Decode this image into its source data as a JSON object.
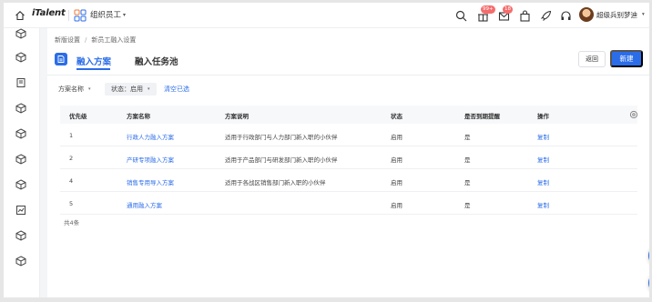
{
  "topbar": {
    "brand": "iTalent",
    "app_title": "组织员工",
    "chevron": "▾",
    "icons": [
      "home-icon",
      "apps-grid-icon",
      "search-icon",
      "gift-icon",
      "mail-icon",
      "bag-icon",
      "rocket-icon",
      "headset-icon"
    ],
    "badges": {
      "gift": "99+",
      "mail": "18"
    },
    "user_name": "超级兵别梦迪",
    "user_chevron": "▾"
  },
  "sidebar": {
    "icons": [
      "cube-icon",
      "cube-icon",
      "book-icon",
      "cube-icon",
      "cube-icon",
      "cube-icon",
      "cube-icon",
      "cube-icon",
      "chart-icon",
      "cube-icon",
      "cube-icon"
    ]
  },
  "breadcrumb": {
    "items": [
      "新版设置",
      "新员工融入设置"
    ],
    "separator": "/"
  },
  "tabs": [
    {
      "label": "融入方案",
      "active": true
    },
    {
      "label": "融入任务池",
      "active": false
    }
  ],
  "actions": {
    "back_label": "返回",
    "new_label": "新建"
  },
  "filters": {
    "name_label": "方案名称",
    "status_label": "状态：启用",
    "clear_label": "清空已选",
    "chevron": "▾"
  },
  "table": {
    "headers": [
      "优先级",
      "方案名称",
      "方案说明",
      "状态",
      "是否到期提醒",
      "操作"
    ],
    "rows": [
      {
        "priority": "1",
        "name": "行政人力融入方案",
        "desc": "适用于行政部门与人力部门新入职的小伙伴",
        "status": "启用",
        "remind": "是",
        "action": "复制"
      },
      {
        "priority": "2",
        "name": "产研专项融入方案",
        "desc": "适用于产品部门与研发部门新入职的小伙伴",
        "status": "启用",
        "remind": "是",
        "action": "复制"
      },
      {
        "priority": "4",
        "name": "销售专用导入方案",
        "desc": "适用于各战区销售部门新入职的小伙伴",
        "status": "启用",
        "remind": "是",
        "action": "复制"
      },
      {
        "priority": "5",
        "name": "通用融入方案",
        "desc": "",
        "status": "启用",
        "remind": "是",
        "action": "复制"
      }
    ],
    "total": "共4条"
  },
  "colors": {
    "primary": "#2b6de8",
    "badge": "#f56c6c"
  }
}
